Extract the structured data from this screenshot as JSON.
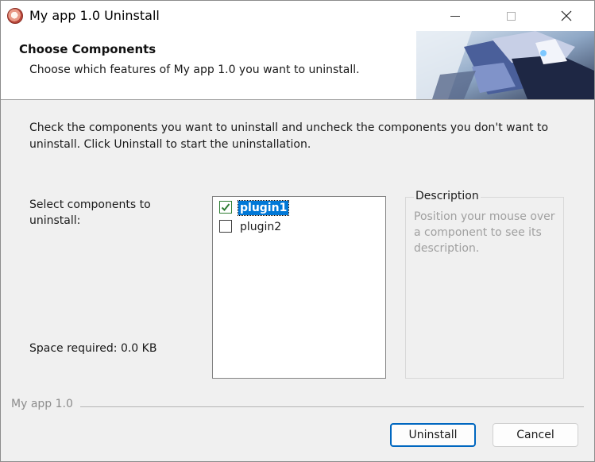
{
  "window": {
    "title": "My app 1.0 Uninstall"
  },
  "header": {
    "title": "Choose Components",
    "subtitle": "Choose which features of My app 1.0 you want to uninstall."
  },
  "body": {
    "intro": "Check the components you want to uninstall and uncheck the components you don't want to uninstall. Click Uninstall to start the uninstallation.",
    "select_label": "Select components to uninstall:",
    "space_required": "Space required: 0.0 KB"
  },
  "components": [
    {
      "label": "plugin1",
      "checked": true,
      "selected": true
    },
    {
      "label": "plugin2",
      "checked": false,
      "selected": false
    }
  ],
  "description": {
    "title": "Description",
    "text": "Position your mouse over a component to see its description."
  },
  "footer": {
    "brand": "My app 1.0",
    "uninstall_label": "Uninstall",
    "cancel_label": "Cancel"
  },
  "colors": {
    "selection": "#0078d7",
    "primary_border": "#0067c0",
    "check_mark": "#2e7d32"
  }
}
